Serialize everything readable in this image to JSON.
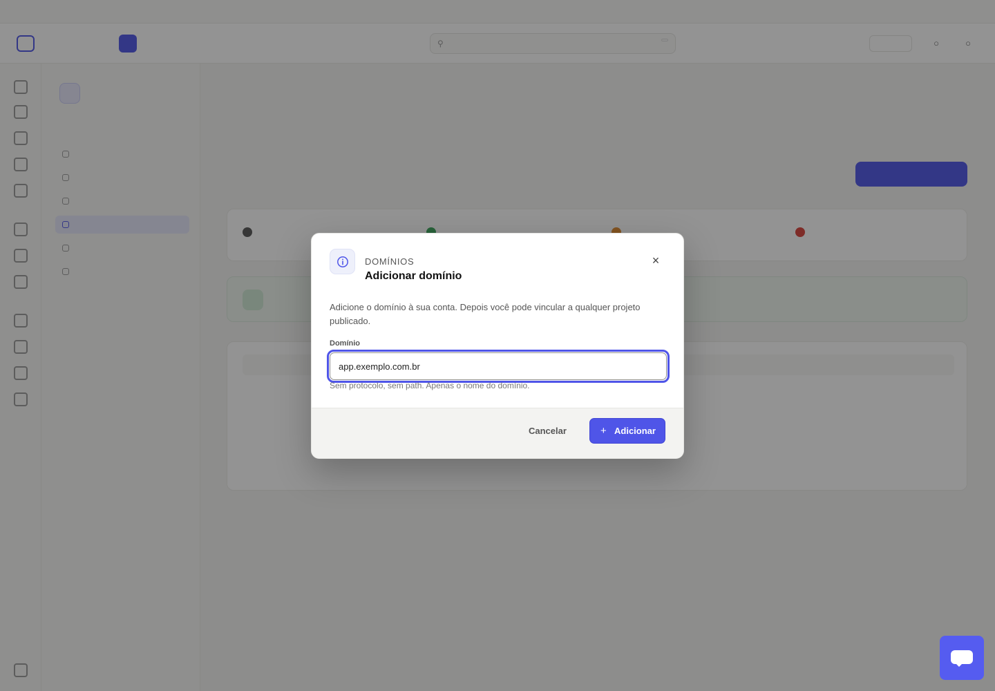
{
  "modal": {
    "eyebrow": "DOMÍNIOS",
    "title": "Adicionar domínio",
    "icon": "info-icon",
    "close_icon": "close-icon",
    "description": "Adicione o domínio à sua conta. Depois você pode vincular a qualquer projeto publicado.",
    "field_label": "Domínio",
    "field_value": "app.exemplo.com.br",
    "hint": "Sem protocolo, sem path. Apenas o nome do domínio.",
    "cancel_label": "Cancelar",
    "add_label": "Adicionar",
    "add_icon": "plus-icon"
  },
  "colors": {
    "accent": "#4f55e8",
    "overlay": "rgba(20,20,20,0.46)",
    "footer_bg": "#f3f3f1"
  },
  "chat_widget": {
    "icon": "chat-bubble-icon"
  }
}
